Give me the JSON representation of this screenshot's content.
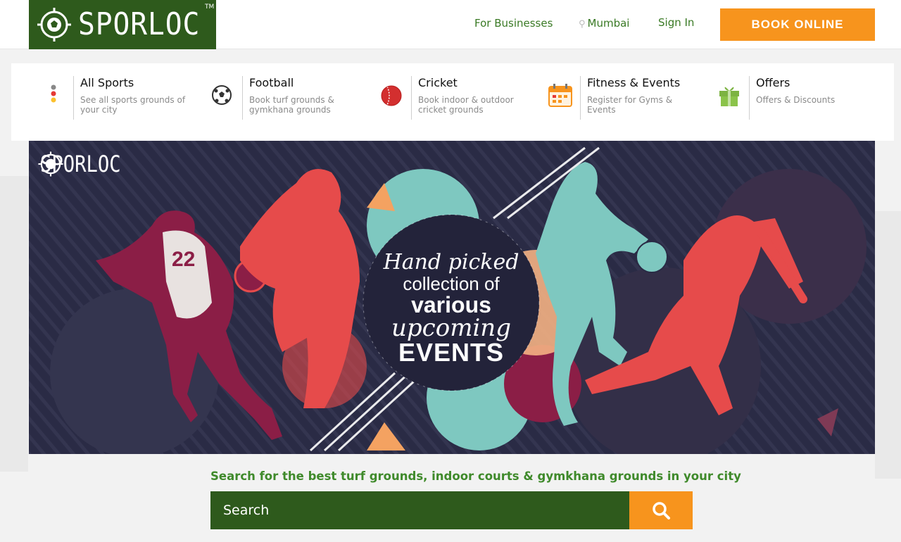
{
  "colors": {
    "brand_green": "#2e5a1c",
    "accent_orange": "#f7941d",
    "link_green": "#3a7a25"
  },
  "header": {
    "logo_text": "SPORLOC",
    "logo_tm": "TM",
    "for_businesses": "For Businesses",
    "location": "Mumbai",
    "sign_in": "Sign In",
    "book_online": "BOOK ONLINE"
  },
  "categories": [
    {
      "title": "All Sports",
      "desc": "See all sports grounds of your city",
      "icon": "traffic-dots-icon"
    },
    {
      "title": "Football",
      "desc": "Book turf grounds & gymkhana grounds",
      "icon": "football-icon"
    },
    {
      "title": "Cricket",
      "desc": "Book indoor & outdoor cricket grounds",
      "icon": "cricket-ball-icon"
    },
    {
      "title": "Fitness & Events",
      "desc": "Register for Gyms & Events",
      "icon": "calendar-icon"
    },
    {
      "title": "Offers",
      "desc": "Offers & Discounts",
      "icon": "gift-icon"
    }
  ],
  "banner": {
    "logo_text": "SPORLOC",
    "line1": "Hand picked",
    "line2": "collection of",
    "line3": "various",
    "line4": "upcoming",
    "line5": "EVENTS"
  },
  "search": {
    "caption": "Search for the best turf grounds, indoor courts & gymkhana grounds in your city",
    "placeholder": "Search",
    "icon": "search-icon"
  }
}
